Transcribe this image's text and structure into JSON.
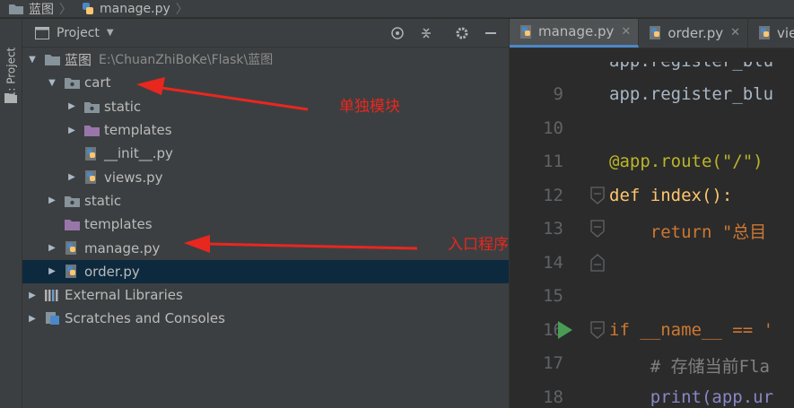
{
  "breadcrumb": {
    "root": "蓝图",
    "file": "manage.py"
  },
  "left_strip": {
    "project_tab": "1: Project"
  },
  "panel": {
    "title": "Project",
    "header_icons": [
      "crosshair-icon",
      "collapse-icon",
      "gear-icon",
      "minimize-icon"
    ]
  },
  "tree": [
    {
      "label": "蓝图",
      "path": "E:\\ChuanZhiBoKe\\Flask\\蓝图",
      "icon": "folder-icon",
      "expanded": true
    },
    {
      "label": "cart",
      "icon": "package-icon",
      "expanded": true
    },
    {
      "label": "static",
      "icon": "package-icon",
      "expanded": false
    },
    {
      "label": "templates",
      "icon": "folder-purple-icon",
      "expanded": false
    },
    {
      "label": "__init__.py",
      "icon": "python-file-icon"
    },
    {
      "label": "views.py",
      "icon": "python-file-icon",
      "expanded": false
    },
    {
      "label": "static",
      "icon": "package-icon",
      "expanded": false
    },
    {
      "label": "templates",
      "icon": "folder-purple-icon"
    },
    {
      "label": "manage.py",
      "icon": "python-file-icon",
      "expanded": false
    },
    {
      "label": "order.py",
      "icon": "python-file-icon",
      "expanded": false,
      "selected": true
    },
    {
      "label": "External Libraries",
      "icon": "libraries-icon",
      "expanded": false
    },
    {
      "label": "Scratches and Consoles",
      "icon": "scratches-icon",
      "expanded": false
    }
  ],
  "tabs": [
    {
      "label": "manage.py",
      "active": true
    },
    {
      "label": "order.py"
    },
    {
      "label": "vie"
    }
  ],
  "code_lines": [
    {
      "n": "",
      "text": "app.register_blu"
    },
    {
      "n": "9",
      "text": "app.register_blu"
    },
    {
      "n": "10",
      "text": ""
    },
    {
      "n": "11",
      "text": "@app.route(\"/\")"
    },
    {
      "n": "12",
      "text": "def index():"
    },
    {
      "n": "13",
      "text": "    return \"总目"
    },
    {
      "n": "14",
      "text": ""
    },
    {
      "n": "15",
      "text": ""
    },
    {
      "n": "16",
      "text": "if __name__ == '"
    },
    {
      "n": "17",
      "text": "    # 存储当前Fla"
    },
    {
      "n": "18",
      "text": "    print(app.ur"
    }
  ],
  "annotations": {
    "module_note": "单独模块",
    "entry_note": "入口程序"
  },
  "colors": {
    "panel_bg": "#3c3f41",
    "editor_bg": "#2b2b2b",
    "selection": "#0d293e",
    "annotation_red": "#e8271f"
  }
}
